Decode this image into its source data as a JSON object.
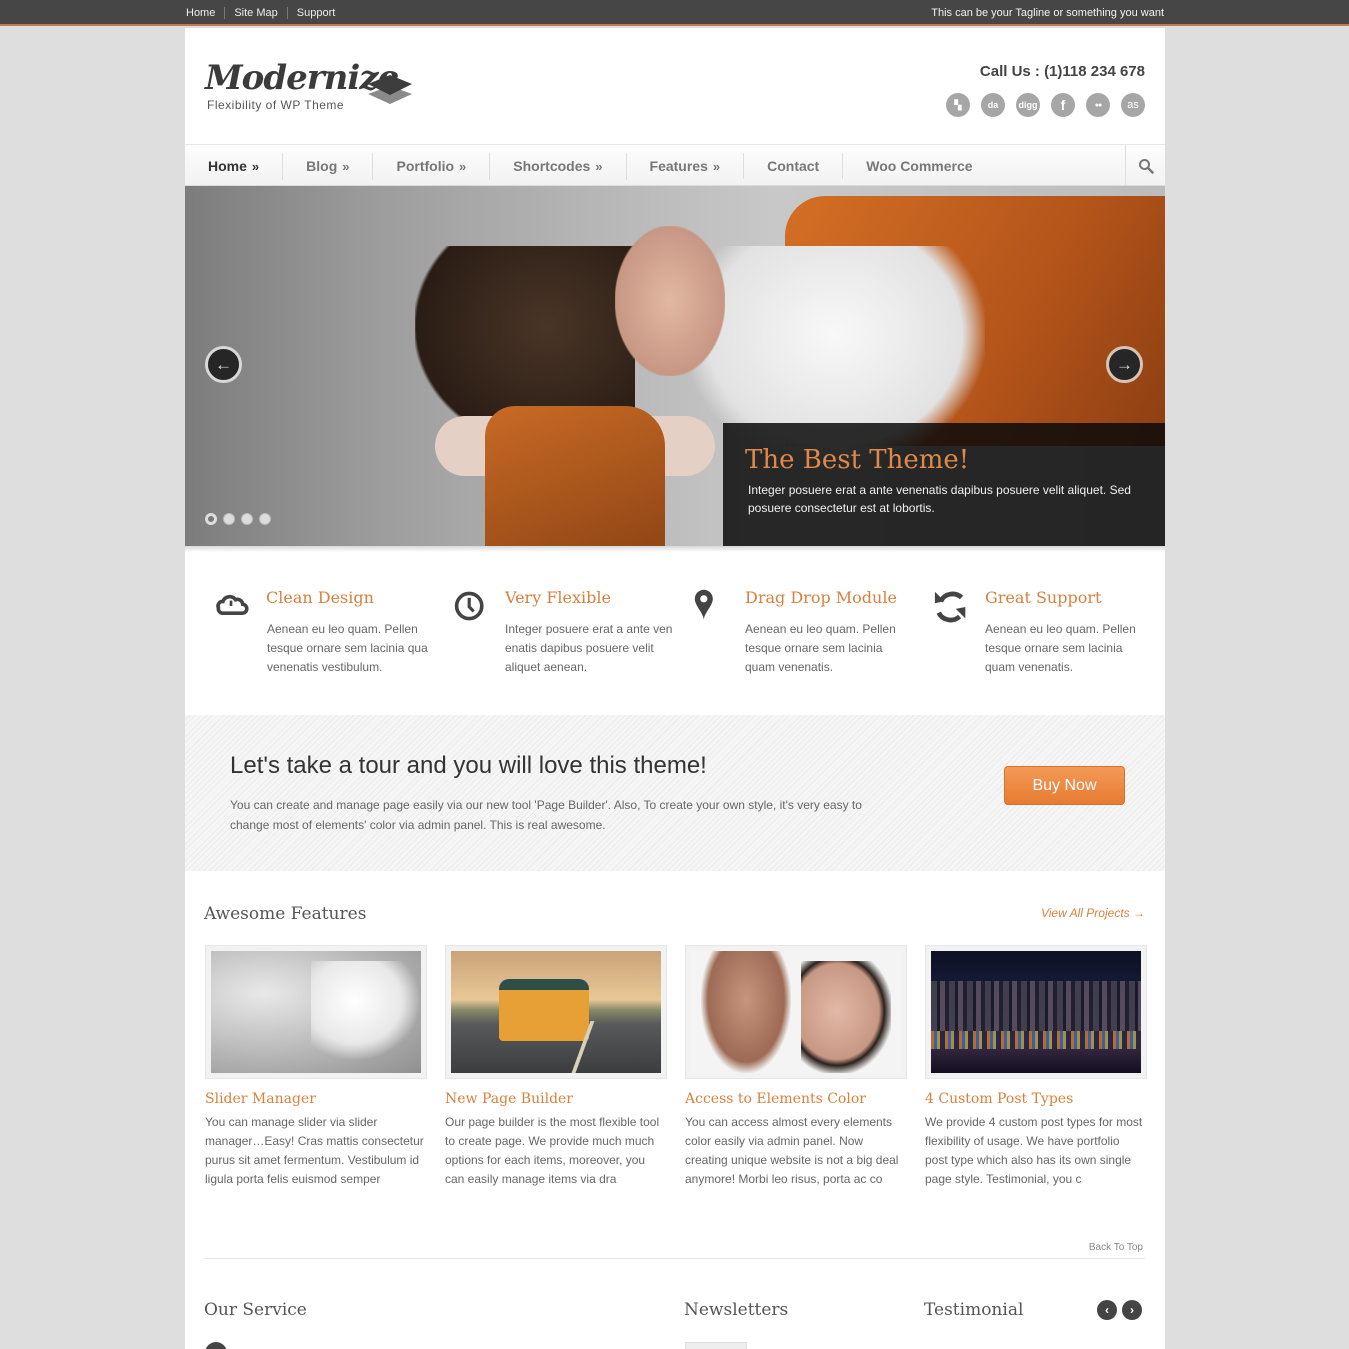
{
  "topbar": {
    "links": [
      "Home",
      "Site Map",
      "Support"
    ],
    "tagline": "This can be your Tagline or something you want"
  },
  "header": {
    "logo_text": "Modernize",
    "logo_subtitle": "Flexibility of WP Theme",
    "call_us": "Call Us : (1)118 234 678",
    "social": [
      {
        "name": "delicious-icon",
        "glyph": "▚"
      },
      {
        "name": "deviantart-icon",
        "glyph": "da"
      },
      {
        "name": "digg-icon",
        "glyph": "digg"
      },
      {
        "name": "facebook-icon",
        "glyph": "f"
      },
      {
        "name": "flickr-icon",
        "glyph": "●●"
      },
      {
        "name": "lastfm-icon",
        "glyph": "as"
      }
    ]
  },
  "nav": {
    "items": [
      {
        "label": "Home",
        "arrow": "»"
      },
      {
        "label": "Blog",
        "arrow": "»"
      },
      {
        "label": "Portfolio",
        "arrow": "»"
      },
      {
        "label": "Shortcodes",
        "arrow": "»"
      },
      {
        "label": "Features",
        "arrow": "»"
      },
      {
        "label": "Contact",
        "arrow": ""
      },
      {
        "label": "Woo Commerce",
        "arrow": ""
      }
    ]
  },
  "slider": {
    "prev": "←",
    "next": "→",
    "caption_title": "The Best Theme!",
    "caption_text": "Integer posuere erat a ante venenatis dapibus posuere velit aliquet. Sed posuere consectetur est at lobortis.",
    "slide_count": 4,
    "active_slide": 1
  },
  "services": [
    {
      "title": "Clean Design",
      "text": "Aenean eu leo quam. Pellen tesque ornare sem lacinia qua venenatis vestibulum.",
      "icon": "cloud-icon"
    },
    {
      "title": "Very Flexible",
      "text": "Integer posuere erat a ante ven enatis dapibus posuere velit aliquet aenean.",
      "icon": "clock-icon"
    },
    {
      "title": "Drag Drop Module",
      "text": "Aenean eu leo quam. Pellen tesque ornare sem lacinia quam venenatis.",
      "icon": "map-pin-icon"
    },
    {
      "title": "Great Support",
      "text": "Aenean eu leo quam. Pellen tesque ornare sem lacinia quam venenatis.",
      "icon": "refresh-icon"
    }
  ],
  "tour": {
    "title": "Let's take a tour and you will love this theme!",
    "text": "You can create and manage page easily via our new tool 'Page Builder'. Also, To create your own style, it's very easy to change most of elements' color via admin panel. This is real awesome.",
    "button": "Buy Now"
  },
  "features": {
    "title": "Awesome Features",
    "view_all": "View All Projects →",
    "items": [
      {
        "title": "Slider Manager",
        "text": "You can manage slider via slider manager…Easy! Cras mattis consectetur purus sit amet fermentum. Vestibulum id ligula porta felis euismod semper"
      },
      {
        "title": "New Page Builder",
        "text": "Our page builder is the most flexible tool to create page. We provide much much options for each items,  moreover, you can easily manage items via dra"
      },
      {
        "title": "Access to Elements Color",
        "text": "You can access almost every elements color easily via admin panel. Now creating unique website is not a big deal anymore! Morbi leo risus, porta ac co"
      },
      {
        "title": "4 Custom Post Types",
        "text": "We provide 4 custom post types for most flexibility of usage. We have portfolio post type which also has its own single page style. Testimonial, you c"
      }
    ],
    "back_to_top": "Back To Top"
  },
  "bottom": {
    "our_service": "Our Service",
    "newsletters": "Newsletters",
    "testimonial": "Testimonial",
    "prev": "‹",
    "next": "›"
  },
  "colors": {
    "accent": "#d9803f",
    "topbar": "#464646",
    "button": "#e77b31"
  }
}
